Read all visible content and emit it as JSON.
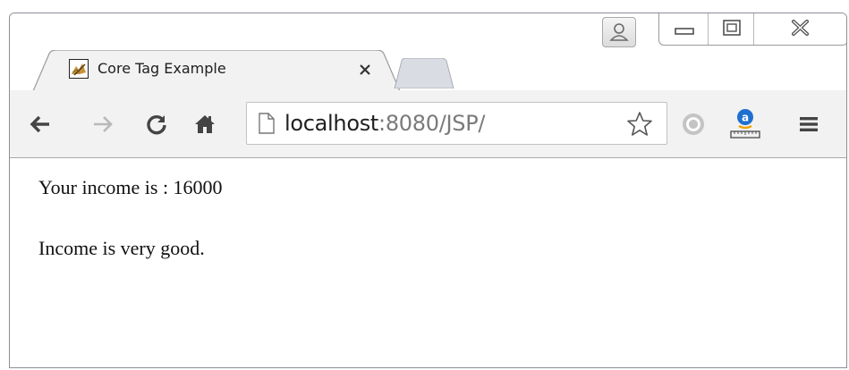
{
  "browser": {
    "tab": {
      "title": "Core Tag Example",
      "close_symbol": "×"
    },
    "address_bar": {
      "host": "localhost",
      "rest": ":8080/JSP/"
    },
    "icons": {
      "favicon": "tomcat-favicon",
      "back": "back-arrow-icon",
      "forward": "forward-arrow-icon",
      "reload": "reload-icon",
      "home": "home-icon",
      "page": "page-icon",
      "bookmark": "star-icon",
      "extension_1": "grey-circle-extension-icon",
      "extension_2": "amazon-extension-icon",
      "menu": "hamburger-menu-icon",
      "profile": "profile-icon",
      "minimize": "minimize-icon",
      "maximize": "maximize-icon",
      "close": "close-window-icon"
    }
  },
  "page": {
    "income_line": "Your income is : 16000",
    "status_line": "Income is very good."
  }
}
